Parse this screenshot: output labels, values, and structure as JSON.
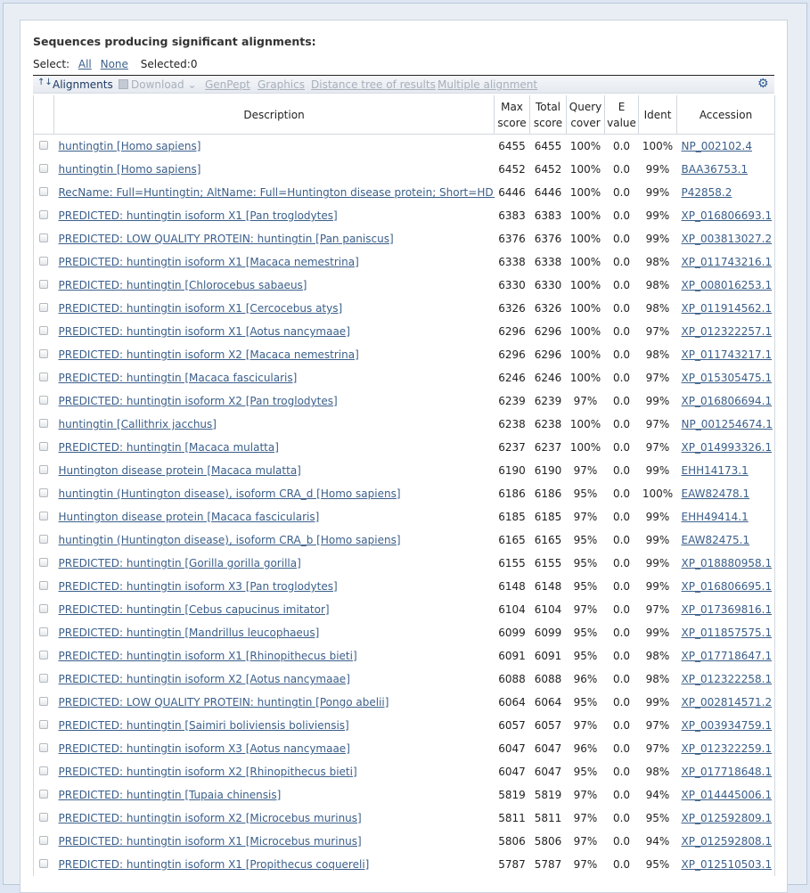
{
  "page_title": "Sequences producing significant alignments:",
  "select": {
    "label": "Select:",
    "all": "All",
    "none": "None",
    "selected": "Selected:0"
  },
  "toolbar": {
    "alignments": "Alignments",
    "download": "Download",
    "genpept": "GenPept",
    "graphics": "Graphics",
    "distance_tree": "Distance tree of results",
    "multiple_alignment": "Multiple alignment"
  },
  "columns": {
    "description": "Description",
    "max_score_1": "Max",
    "max_score_2": "score",
    "total_score_1": "Total",
    "total_score_2": "score",
    "query_cover_1": "Query",
    "query_cover_2": "cover",
    "e_value_1": "E",
    "e_value_2": "value",
    "ident": "Ident",
    "accession": "Accession"
  },
  "rows": [
    {
      "description": "huntingtin [Homo sapiens]",
      "max": "6455",
      "total": "6455",
      "cover": "100%",
      "e": "0.0",
      "ident": "100%",
      "accession": "NP_002102.4"
    },
    {
      "description": "huntingtin [Homo sapiens]",
      "max": "6452",
      "total": "6452",
      "cover": "100%",
      "e": "0.0",
      "ident": "99%",
      "accession": "BAA36753.1"
    },
    {
      "description": "RecName: Full=Huntingtin; AltName: Full=Huntington disease protein; Short=HD protein",
      "max": "6446",
      "total": "6446",
      "cover": "100%",
      "e": "0.0",
      "ident": "99%",
      "accession": "P42858.2"
    },
    {
      "description": "PREDICTED: huntingtin isoform X1 [Pan troglodytes]",
      "max": "6383",
      "total": "6383",
      "cover": "100%",
      "e": "0.0",
      "ident": "99%",
      "accession": "XP_016806693.1"
    },
    {
      "description": "PREDICTED: LOW QUALITY PROTEIN: huntingtin [Pan paniscus]",
      "max": "6376",
      "total": "6376",
      "cover": "100%",
      "e": "0.0",
      "ident": "99%",
      "accession": "XP_003813027.2"
    },
    {
      "description": "PREDICTED: huntingtin isoform X1 [Macaca nemestrina]",
      "max": "6338",
      "total": "6338",
      "cover": "100%",
      "e": "0.0",
      "ident": "98%",
      "accession": "XP_011743216.1"
    },
    {
      "description": "PREDICTED: huntingtin [Chlorocebus sabaeus]",
      "max": "6330",
      "total": "6330",
      "cover": "100%",
      "e": "0.0",
      "ident": "98%",
      "accession": "XP_008016253.1"
    },
    {
      "description": "PREDICTED: huntingtin isoform X1 [Cercocebus atys]",
      "max": "6326",
      "total": "6326",
      "cover": "100%",
      "e": "0.0",
      "ident": "98%",
      "accession": "XP_011914562.1"
    },
    {
      "description": "PREDICTED: huntingtin isoform X1 [Aotus nancymaae]",
      "max": "6296",
      "total": "6296",
      "cover": "100%",
      "e": "0.0",
      "ident": "97%",
      "accession": "XP_012322257.1"
    },
    {
      "description": "PREDICTED: huntingtin isoform X2 [Macaca nemestrina]",
      "max": "6296",
      "total": "6296",
      "cover": "100%",
      "e": "0.0",
      "ident": "98%",
      "accession": "XP_011743217.1"
    },
    {
      "description": "PREDICTED: huntingtin [Macaca fascicularis]",
      "max": "6246",
      "total": "6246",
      "cover": "100%",
      "e": "0.0",
      "ident": "97%",
      "accession": "XP_015305475.1"
    },
    {
      "description": "PREDICTED: huntingtin isoform X2 [Pan troglodytes]",
      "max": "6239",
      "total": "6239",
      "cover": "97%",
      "e": "0.0",
      "ident": "99%",
      "accession": "XP_016806694.1"
    },
    {
      "description": "huntingtin [Callithrix jacchus]",
      "max": "6238",
      "total": "6238",
      "cover": "100%",
      "e": "0.0",
      "ident": "97%",
      "accession": "NP_001254674.1"
    },
    {
      "description": "PREDICTED: huntingtin [Macaca mulatta]",
      "max": "6237",
      "total": "6237",
      "cover": "100%",
      "e": "0.0",
      "ident": "97%",
      "accession": "XP_014993326.1"
    },
    {
      "description": "Huntington disease protein [Macaca mulatta]",
      "max": "6190",
      "total": "6190",
      "cover": "97%",
      "e": "0.0",
      "ident": "99%",
      "accession": "EHH14173.1"
    },
    {
      "description": "huntingtin (Huntington disease), isoform CRA_d [Homo sapiens]",
      "max": "6186",
      "total": "6186",
      "cover": "95%",
      "e": "0.0",
      "ident": "100%",
      "accession": "EAW82478.1"
    },
    {
      "description": "Huntington disease protein [Macaca fascicularis]",
      "max": "6185",
      "total": "6185",
      "cover": "97%",
      "e": "0.0",
      "ident": "99%",
      "accession": "EHH49414.1"
    },
    {
      "description": "huntingtin (Huntington disease), isoform CRA_b [Homo sapiens]",
      "max": "6165",
      "total": "6165",
      "cover": "95%",
      "e": "0.0",
      "ident": "99%",
      "accession": "EAW82475.1"
    },
    {
      "description": "PREDICTED: huntingtin [Gorilla gorilla gorilla]",
      "max": "6155",
      "total": "6155",
      "cover": "95%",
      "e": "0.0",
      "ident": "99%",
      "accession": "XP_018880958.1"
    },
    {
      "description": "PREDICTED: huntingtin isoform X3 [Pan troglodytes]",
      "max": "6148",
      "total": "6148",
      "cover": "95%",
      "e": "0.0",
      "ident": "99%",
      "accession": "XP_016806695.1"
    },
    {
      "description": "PREDICTED: huntingtin [Cebus capucinus imitator]",
      "max": "6104",
      "total": "6104",
      "cover": "97%",
      "e": "0.0",
      "ident": "97%",
      "accession": "XP_017369816.1"
    },
    {
      "description": "PREDICTED: huntingtin [Mandrillus leucophaeus]",
      "max": "6099",
      "total": "6099",
      "cover": "95%",
      "e": "0.0",
      "ident": "99%",
      "accession": "XP_011857575.1"
    },
    {
      "description": "PREDICTED: huntingtin isoform X1 [Rhinopithecus bieti]",
      "max": "6091",
      "total": "6091",
      "cover": "95%",
      "e": "0.0",
      "ident": "98%",
      "accession": "XP_017718647.1"
    },
    {
      "description": "PREDICTED: huntingtin isoform X2 [Aotus nancymaae]",
      "max": "6088",
      "total": "6088",
      "cover": "96%",
      "e": "0.0",
      "ident": "98%",
      "accession": "XP_012322258.1"
    },
    {
      "description": "PREDICTED: LOW QUALITY PROTEIN: huntingtin [Pongo abelii]",
      "max": "6064",
      "total": "6064",
      "cover": "95%",
      "e": "0.0",
      "ident": "99%",
      "accession": "XP_002814571.2"
    },
    {
      "description": "PREDICTED: huntingtin [Saimiri boliviensis boliviensis]",
      "max": "6057",
      "total": "6057",
      "cover": "97%",
      "e": "0.0",
      "ident": "97%",
      "accession": "XP_003934759.1"
    },
    {
      "description": "PREDICTED: huntingtin isoform X3 [Aotus nancymaae]",
      "max": "6047",
      "total": "6047",
      "cover": "96%",
      "e": "0.0",
      "ident": "97%",
      "accession": "XP_012322259.1"
    },
    {
      "description": "PREDICTED: huntingtin isoform X2 [Rhinopithecus bieti]",
      "max": "6047",
      "total": "6047",
      "cover": "95%",
      "e": "0.0",
      "ident": "98%",
      "accession": "XP_017718648.1"
    },
    {
      "description": "PREDICTED: huntingtin [Tupaia chinensis]",
      "max": "5819",
      "total": "5819",
      "cover": "97%",
      "e": "0.0",
      "ident": "94%",
      "accession": "XP_014445006.1"
    },
    {
      "description": "PREDICTED: huntingtin isoform X2 [Microcebus murinus]",
      "max": "5811",
      "total": "5811",
      "cover": "97%",
      "e": "0.0",
      "ident": "95%",
      "accession": "XP_012592809.1"
    },
    {
      "description": "PREDICTED: huntingtin isoform X1 [Microcebus murinus]",
      "max": "5806",
      "total": "5806",
      "cover": "97%",
      "e": "0.0",
      "ident": "94%",
      "accession": "XP_012592808.1"
    },
    {
      "description": "PREDICTED: huntingtin isoform X1 [Propithecus coquereli]",
      "max": "5787",
      "total": "5787",
      "cover": "97%",
      "e": "0.0",
      "ident": "95%",
      "accession": "XP_012510503.1"
    }
  ]
}
